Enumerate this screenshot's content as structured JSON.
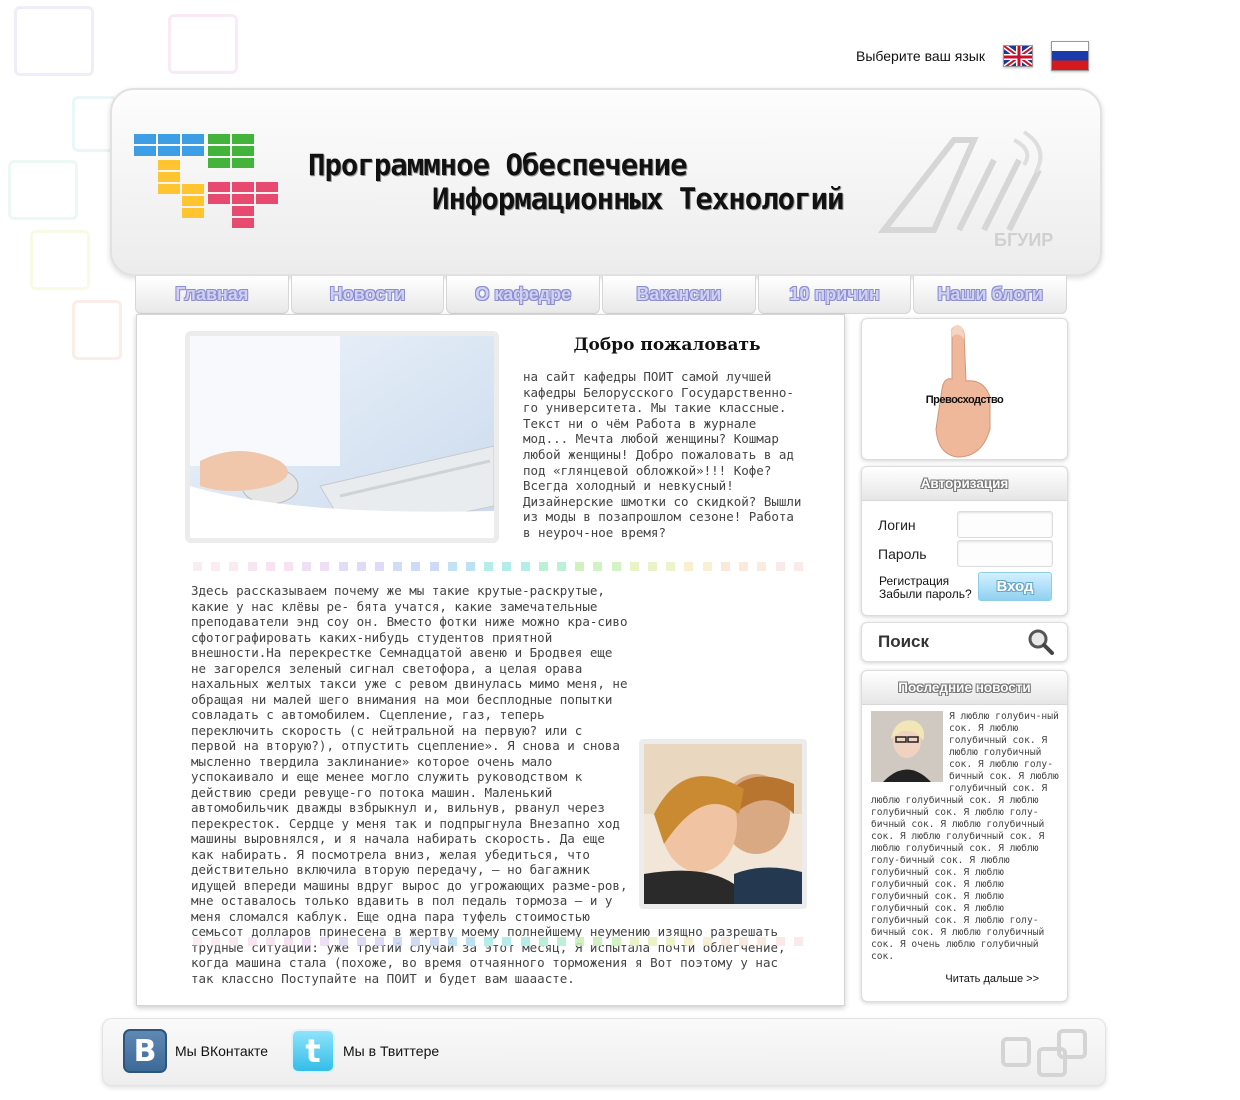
{
  "language": {
    "label": "Выберите ваш язык",
    "options": [
      "English",
      "Русский"
    ]
  },
  "header": {
    "title_line1": "Программное Обеспечение",
    "title_line2": "Информационных Технологий",
    "partner_logo_text": "БГУИР"
  },
  "nav": {
    "items": [
      "Главная",
      "Новости",
      "О кафедре",
      "Вакансии",
      "10 причин",
      "Наши блоги"
    ]
  },
  "welcome": {
    "title": "Добро пожаловать",
    "text": "на сайт кафедры ПОИТ самой лучшей кафедры Белорусского Государственно-го университета. Мы такие классные. Текст ни о чём Работа в журнале мод... Мечта любой женщины? Кошмар любой женщины! Добро пожаловать в ад под «глянцевой обложкой»!!! Кофе? Всегда холодный и невкусный! Дизайнерские шмотки со скидкой? Вышли из моды в позапрошлом сезоне! Работа в неуроч-ное время?"
  },
  "article": {
    "text": "Здесь рассказываем почему же мы такие крутые-раскрутые, какие у нас клёвы ре- бята учатся, какие замечательные преподаватели энд соу он. Вместо фотки ниже можно кра-сиво сфотографировать каких-нибудь студентов приятной внешности.На перекрестке Семнадцатой авеню и Бродвея еще не загорелся зеленый сигнал светофора, а целая орава нахальных желтых такси уже с ревом двинулась мимо меня, не обращая ни малей шего внимания на мои бесплодные попытки совладать с автомобилем. Сцепление, газ, теперь переключить скорость (с нейтральной на первую? или с первой на вторую?), отпустить сцепление». Я снова и снова мысленно твердила заклинание» которое очень мало успокаивало и еще менее могло служить руководством к действию среди ревуще-го потока машин. Маленький автомобильчик дважды взбрыкнул и, вильнув, рванул через перекресток. Сердце у меня так и подпрыгнула Внезапно ход машины выровнялся, и я начала набирать скорость. Да еще как набирать. Я посмотрела вниз, желая убедиться, что действительно включила вторую передачу, — но багажник идущей впереди машины вдруг вырос до угрожающих разме-ров, мне оставалось только вдавить в пол педаль тормоза — и у меня сломался каблук. Еще одна пара туфель стоимостью семьсот долларов принесена в жертву моему полнейшему неумению изящно разрешать трудные ситуации: уже третий случай за этот месяц, Я испытала почти облегчение, когда машина стала (похоже, во время отчаянного торможения я Вот поэтому у нас так классно Поступайте на ПОИТ и будет вам шааасте."
  },
  "sidebar": {
    "promo_label": "Превосходство",
    "auth": {
      "title": "Авторизация",
      "login_label": "Логин",
      "password_label": "Пароль",
      "register_link": "Регистрация",
      "forgot_link": "Забыли пароль?",
      "submit_label": "Вход"
    },
    "search": {
      "label": "Поиск"
    },
    "news": {
      "title": "Последние новости",
      "text": "Я люблю голубич-ный сок. Я люблю голубичный сок. Я люблю голубичный сок. Я люблю голу-бичный сок. Я люблю голубичный сок. Я люблю голубичный сок. Я люблю голубичный сок. Я люблю голу-бичный сок. Я люблю голубичный сок. Я люблю голубичный сок. Я люблю голубичный сок. Я люблю голу-бичный сок. Я люблю голубичный сок. Я люблю голубичный сок. Я люблю голубичный сок. Я люблю голубичный сок. Я люблю голубичный сок. Я люблю голу-бичный сок. Я люблю голубичный сок. Я очень люблю голубичный сок.",
      "read_more": "Читать дальше >>"
    }
  },
  "footer": {
    "vk_label": "Мы ВКонтакте",
    "twitter_label": "Мы в Твиттере",
    "vk_icon_letter": "B",
    "twitter_icon_letter": "t"
  },
  "colors": {
    "nav_text": "#cfd0f2",
    "nav_outline": "#8c8fcf",
    "login_button": "#8fd1f1",
    "vk_blue": "#4c75a3",
    "twitter_blue": "#33bde9"
  }
}
